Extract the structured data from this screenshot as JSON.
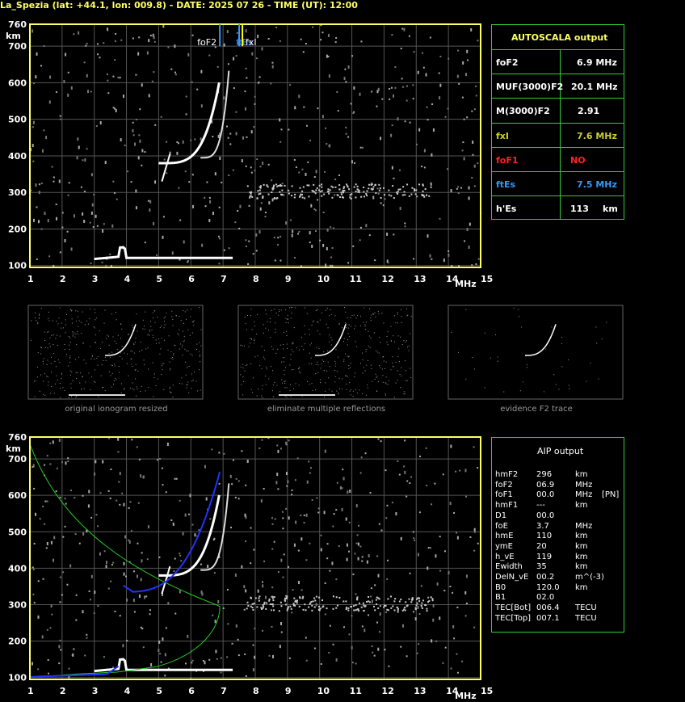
{
  "title": "La_Spezia (lat: +44.1, lon: 009.8) - DATE: 2025 07 26 - TIME (UT): 12:00",
  "colors": {
    "axis": "#ffff66",
    "grid": "#555555",
    "panel_border": "#33cc33",
    "fof2_marker": "#3399ff",
    "fxi_marker": "#ffff00",
    "fof1": "#ff2222",
    "ftes": "#3399ff",
    "fxi": "#cccc33",
    "profile_green": "#22cc22",
    "profile_blue": "#2233ff"
  },
  "chart_data": [
    {
      "type": "scatter",
      "name": "ionogram-top",
      "xlabel": "MHz",
      "ylabel": "km",
      "xlim": [
        1,
        15
      ],
      "ylim": [
        95,
        760
      ],
      "x_ticks": [
        1,
        2,
        3,
        4,
        5,
        6,
        7,
        8,
        9,
        10,
        11,
        12,
        13,
        14,
        15
      ],
      "y_ticks": [
        100,
        200,
        300,
        400,
        500,
        600,
        700,
        760
      ],
      "grid": true,
      "markers": [
        {
          "label": "foF2",
          "x": 6.9
        },
        {
          "label": "ftEs",
          "x": 7.5
        },
        {
          "label": "fxI",
          "x": 7.6
        }
      ]
    },
    {
      "type": "scatter",
      "name": "ionogram-aip",
      "xlabel": "MHz",
      "ylabel": "km",
      "xlim": [
        1,
        15
      ],
      "ylim": [
        95,
        760
      ],
      "x_ticks": [
        1,
        2,
        3,
        4,
        5,
        6,
        7,
        8,
        9,
        10,
        11,
        12,
        13,
        14,
        15
      ],
      "y_ticks": [
        100,
        200,
        300,
        400,
        500,
        600,
        700,
        760
      ],
      "grid": true
    }
  ],
  "thumbnails": [
    {
      "caption": "original ionogram resized"
    },
    {
      "caption": "eliminate multiple reflections"
    },
    {
      "caption": "evidence F2 trace"
    }
  ],
  "autoscala": {
    "header": "AUTOSCALA output",
    "rows": [
      {
        "label": "foF2",
        "value": "6.9 MHz",
        "color": "#ffffff"
      },
      {
        "label": "MUF(3000)F2",
        "value": "20.1 MHz",
        "color": "#ffffff"
      },
      {
        "label": "M(3000)F2",
        "value": "2.91",
        "color": "#ffffff"
      },
      {
        "label": "fxI",
        "value": "7.6 MHz",
        "color": "#cccc33"
      },
      {
        "label": "foF1",
        "value": "NO",
        "color": "#ff2222"
      },
      {
        "label": "ftEs",
        "value": "7.5 MHz",
        "color": "#3399ff"
      },
      {
        "label": "h'Es",
        "value": "113",
        "unit": "km",
        "color": "#ffffff"
      }
    ]
  },
  "aip": {
    "header": "AIP output",
    "rows": [
      {
        "name": "hmF2",
        "value": "296",
        "unit": "km",
        "extra": ""
      },
      {
        "name": "foF2",
        "value": "06.9",
        "unit": "MHz",
        "extra": ""
      },
      {
        "name": "foF1",
        "value": "00.0",
        "unit": "MHz",
        "extra": "[PN]"
      },
      {
        "name": "hmF1",
        "value": "---",
        "unit": "km",
        "extra": ""
      },
      {
        "name": "D1",
        "value": "00.0",
        "unit": "",
        "extra": ""
      },
      {
        "name": "foE",
        "value": "3.7",
        "unit": "MHz",
        "extra": ""
      },
      {
        "name": "hmE",
        "value": "110",
        "unit": "km",
        "extra": ""
      },
      {
        "name": "ymE",
        "value": "20",
        "unit": "km",
        "extra": ""
      },
      {
        "name": "h_vE",
        "value": "119",
        "unit": "km",
        "extra": ""
      },
      {
        "name": "Ewidth",
        "value": "35",
        "unit": "km",
        "extra": ""
      },
      {
        "name": "DelN_vE",
        "value": "00.2",
        "unit": "m^(-3)",
        "extra": ""
      },
      {
        "name": "B0",
        "value": "120.0",
        "unit": "km",
        "extra": ""
      },
      {
        "name": "B1",
        "value": "02.0",
        "unit": "",
        "extra": ""
      },
      {
        "name": "TEC[Bot]",
        "value": "006.4",
        "unit": "TECU",
        "extra": ""
      },
      {
        "name": "TEC[Top]",
        "value": "007.1",
        "unit": "TECU",
        "extra": ""
      }
    ]
  }
}
